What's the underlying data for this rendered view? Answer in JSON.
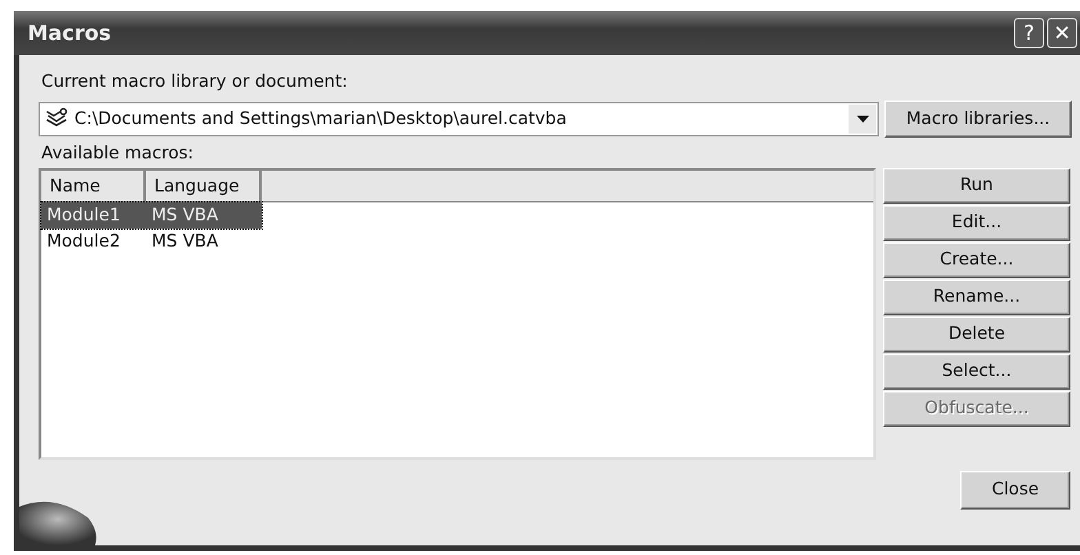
{
  "window": {
    "title": "Macros",
    "controls": [
      "?",
      "✕"
    ]
  },
  "library": {
    "label": "Current macro library or document:",
    "value": "C:\\Documents and Settings\\marian\\Desktop\\aurel.catvba",
    "button": "Macro libraries..."
  },
  "macros": {
    "label": "Available macros:",
    "columns": [
      "Name",
      "Language"
    ],
    "rows": [
      {
        "cells": [
          "Module1",
          "MS VBA"
        ],
        "selected": true
      },
      {
        "cells": [
          "Module2",
          "MS VBA"
        ],
        "selected": false
      }
    ]
  },
  "actions": [
    {
      "label": "Run",
      "disabled": false
    },
    {
      "label": "Edit...",
      "disabled": false
    },
    {
      "label": "Create...",
      "disabled": false
    },
    {
      "label": "Rename...",
      "disabled": false
    },
    {
      "label": "Delete",
      "disabled": false
    },
    {
      "label": "Select...",
      "disabled": false
    },
    {
      "label": "Obfuscate...",
      "disabled": true
    }
  ],
  "close": "Close"
}
